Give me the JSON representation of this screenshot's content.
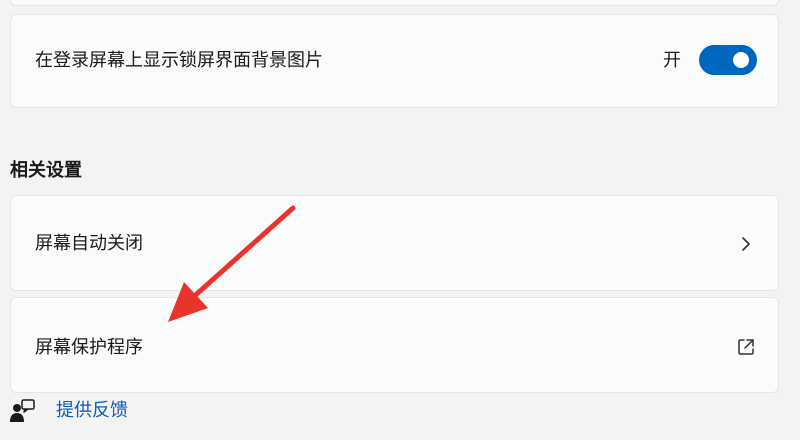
{
  "lock_screen": {
    "background_label": "在登录屏幕上显示锁屏界面背景图片",
    "toggle_state": "开",
    "toggle_on": true
  },
  "related_settings": {
    "header": "相关设置",
    "items": [
      {
        "label": "屏幕自动关闭",
        "icon": "chevron-right-icon"
      },
      {
        "label": "屏幕保护程序",
        "icon": "external-link-icon"
      }
    ]
  },
  "footer": {
    "feedback_label": "提供反馈",
    "feedback_icon": "feedback-icon"
  },
  "colors": {
    "accent": "#0067c0",
    "link": "#0a5fb4",
    "annotation_arrow": "#e8342b"
  }
}
